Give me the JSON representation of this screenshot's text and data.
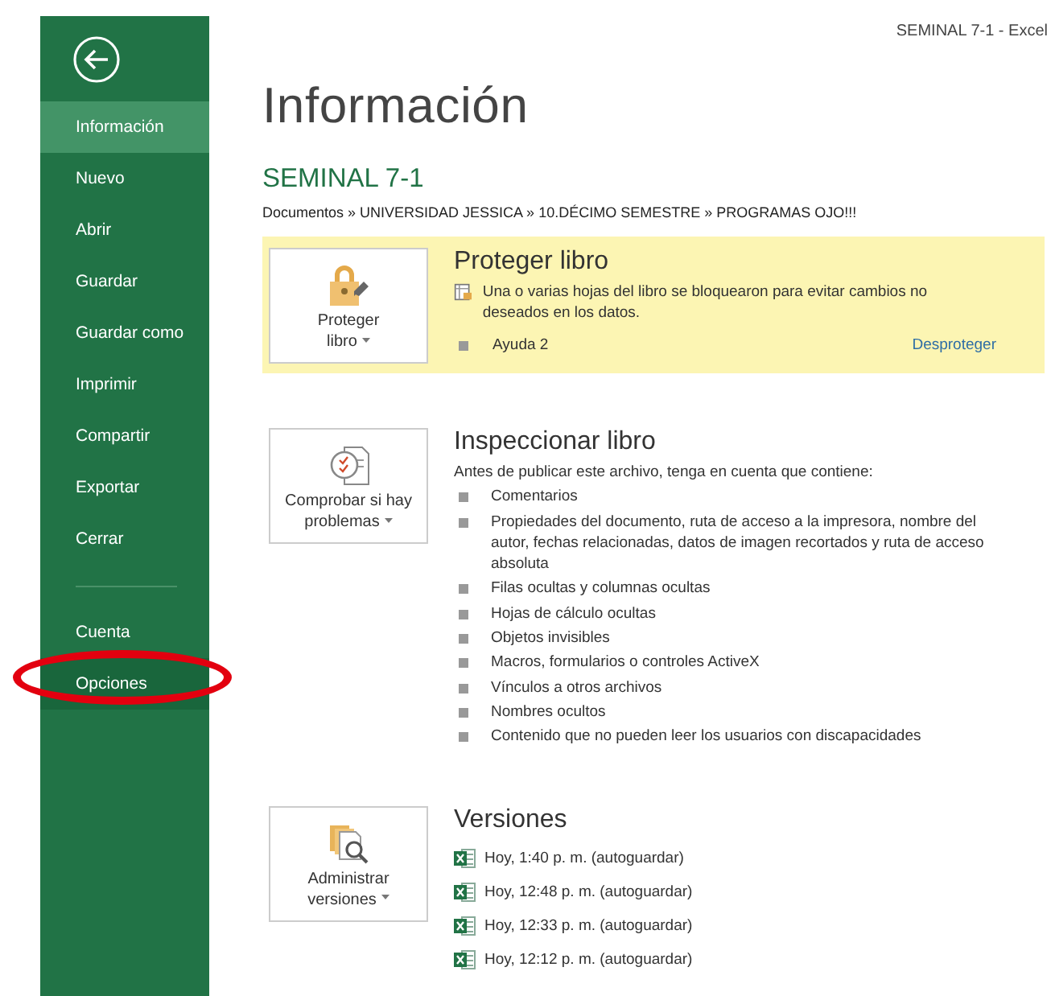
{
  "window": {
    "title": "SEMINAL 7-1 - Excel"
  },
  "sidebar": {
    "items": [
      {
        "label": "Información",
        "selected": true,
        "circled": false
      },
      {
        "label": "Nuevo",
        "selected": false,
        "circled": false
      },
      {
        "label": "Abrir",
        "selected": false,
        "circled": false
      },
      {
        "label": "Guardar",
        "selected": false,
        "circled": false
      },
      {
        "label": "Guardar como",
        "selected": false,
        "circled": false
      },
      {
        "label": "Imprimir",
        "selected": false,
        "circled": false
      },
      {
        "label": "Compartir",
        "selected": false,
        "circled": false
      },
      {
        "label": "Exportar",
        "selected": false,
        "circled": false
      },
      {
        "label": "Cerrar",
        "selected": false,
        "circled": false
      }
    ],
    "bottom_items": [
      {
        "label": "Cuenta",
        "selected": false,
        "circled": false
      },
      {
        "label": "Opciones",
        "selected": false,
        "circled": true
      }
    ]
  },
  "page": {
    "title": "Información",
    "file_name": "SEMINAL 7-1",
    "path": "Documentos » UNIVERSIDAD JESSICA » 10.DÉCIMO SEMESTRE » PROGRAMAS OJO!!!"
  },
  "sections": [
    {
      "kind": "protect",
      "warning": true,
      "button": "Proteger libro",
      "heading": "Proteger libro",
      "description": "Una o varias hojas del libro se bloquearon para evitar cambios no deseados en los datos.",
      "items": [
        "Ayuda 2"
      ],
      "link": "Desproteger"
    },
    {
      "kind": "inspect",
      "warning": false,
      "button": "Comprobar si hay problemas",
      "heading": "Inspeccionar libro",
      "description": "Antes de publicar este archivo, tenga en cuenta que contiene:",
      "items": [
        "Comentarios",
        "Propiedades del documento, ruta de acceso a la impresora, nombre del autor, fechas relacionadas, datos de imagen recortados y ruta de acceso absoluta",
        "Filas ocultas y columnas ocultas",
        "Hojas de cálculo ocultas",
        "Objetos invisibles",
        "Macros, formularios o controles ActiveX",
        "Vínculos a otros archivos",
        "Nombres ocultos",
        "Contenido que no pueden leer los usuarios con discapacidades"
      ]
    },
    {
      "kind": "versions",
      "warning": false,
      "button": "Administrar versiones",
      "heading": "Versiones",
      "items": [
        "Hoy, 1:40 p. m. (autoguardar)",
        "Hoy, 12:48 p. m. (autoguardar)",
        "Hoy, 12:33 p. m. (autoguardar)",
        "Hoy, 12:12 p. m. (autoguardar)"
      ]
    }
  ]
}
